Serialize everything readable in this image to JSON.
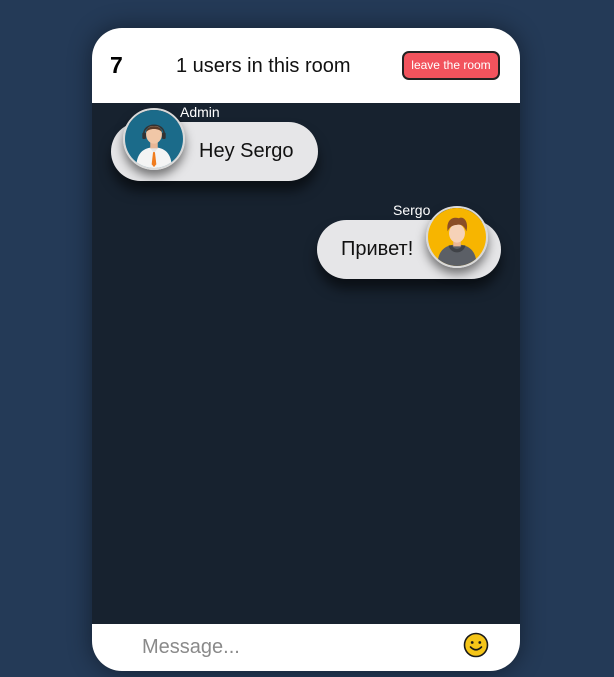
{
  "header": {
    "room_number": "7",
    "users_text": "1 users in this room",
    "leave_label": "leave the room"
  },
  "messages": [
    {
      "user": "Admin",
      "text": "Hey Sergo",
      "side": "left",
      "avatar": "admin-avatar-icon"
    },
    {
      "user": "Sergo",
      "text": "Привет!",
      "side": "right",
      "avatar": "sergo-avatar-icon"
    }
  ],
  "composer": {
    "placeholder": "Message...",
    "emoji_icon": "smiley-emoji-icon"
  },
  "colors": {
    "page_background": "#243a57",
    "chat_background": "#17222f",
    "bubble": "#e6e6e8",
    "leave_button": "#f2535d",
    "admin_avatar_bg": "#1b6b8a",
    "sergo_avatar_bg": "#f7b500",
    "emoji": "#f5c518"
  }
}
